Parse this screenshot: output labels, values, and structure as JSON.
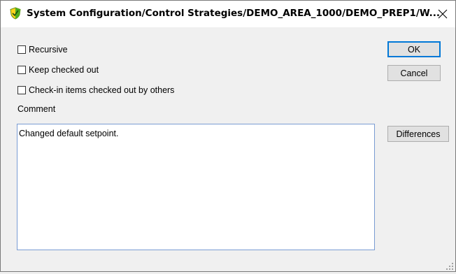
{
  "window": {
    "title": "System Configuration/Control Strategies/DEMO_AREA_1000/DEMO_PREP1/W...",
    "app_icon": "shield-icon",
    "close_icon": "close-icon"
  },
  "options": {
    "recursive_label": "Recursive",
    "recursive_checked": false,
    "keep_checked_out_label": "Keep checked out",
    "keep_checked_out_checked": false,
    "checkin_others_label": "Check-in items checked out by others",
    "checkin_others_checked": false
  },
  "comment": {
    "label": "Comment",
    "value": "Changed default setpoint."
  },
  "buttons": {
    "ok_label": "OK",
    "cancel_label": "Cancel",
    "differences_label": "Differences"
  },
  "colors": {
    "accent": "#0078d7",
    "window_bg": "#f0f0f0",
    "icon_green": "#4caf1e",
    "icon_yellow": "#ffd21c"
  }
}
